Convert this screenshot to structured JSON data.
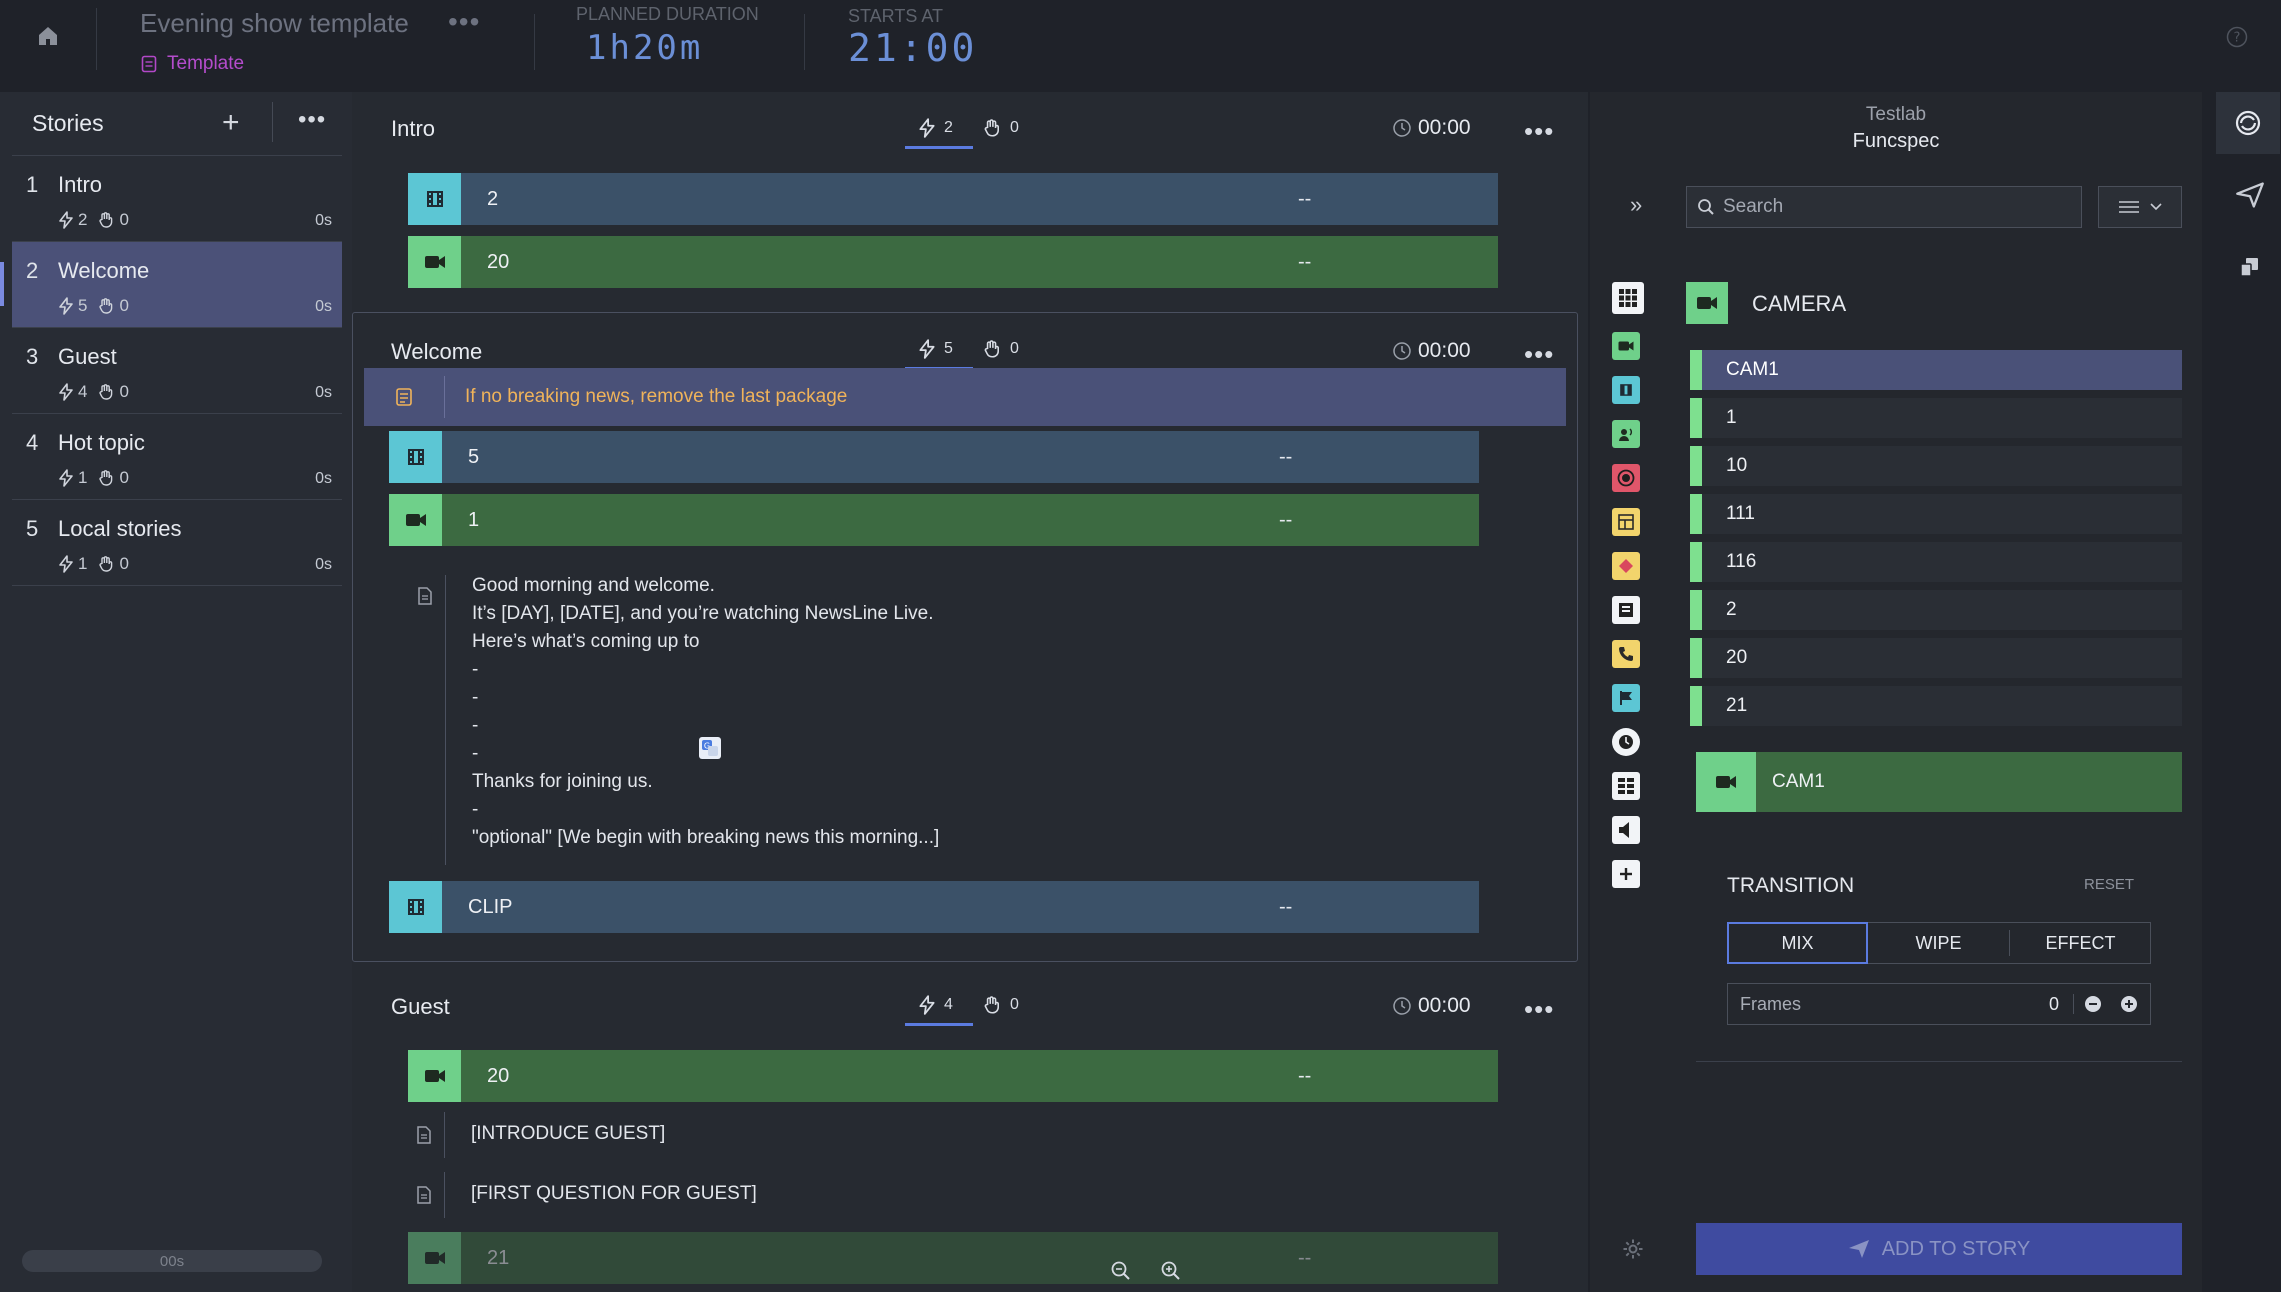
{
  "topbar": {
    "show_title": "Evening show template",
    "template_label": "Template",
    "planned_label": "PLANNED DURATION",
    "planned_value": "1h20m",
    "starts_label": "STARTS AT",
    "starts_value": "21:00"
  },
  "stories": {
    "header": "Stories",
    "items": [
      {
        "num": "1",
        "title": "Intro",
        "bolts": "2",
        "hands": "0",
        "time": "0s"
      },
      {
        "num": "2",
        "title": "Welcome",
        "bolts": "5",
        "hands": "0",
        "time": "0s"
      },
      {
        "num": "3",
        "title": "Guest",
        "bolts": "4",
        "hands": "0",
        "time": "0s"
      },
      {
        "num": "4",
        "title": "Hot topic",
        "bolts": "1",
        "hands": "0",
        "time": "0s"
      },
      {
        "num": "5",
        "title": "Local stories",
        "bolts": "1",
        "hands": "0",
        "time": "0s"
      }
    ],
    "footer_time": "00s"
  },
  "rundown": {
    "intro": {
      "title": "Intro",
      "bolts": "2",
      "hands": "0",
      "time": "00:00",
      "rows": [
        {
          "label": "2",
          "dash": "--"
        },
        {
          "label": "20",
          "dash": "--"
        }
      ]
    },
    "welcome": {
      "title": "Welcome",
      "bolts": "5",
      "hands": "0",
      "time": "00:00",
      "note": "If no breaking news, remove the last package",
      "rows": [
        {
          "label": "5",
          "dash": "--"
        },
        {
          "label": "1",
          "dash": "--"
        },
        {
          "label": "CLIP",
          "dash": "--"
        }
      ],
      "script": [
        "Good morning and welcome.",
        "It’s [DAY], [DATE], and you’re watching NewsLine Live.",
        "Here’s what’s coming up to",
        "-",
        "-",
        "-",
        "-",
        "Thanks for joining us.",
        "-",
        "\"optional\" [We begin with breaking news this morning...]"
      ]
    },
    "guest": {
      "title": "Guest",
      "bolts": "4",
      "hands": "0",
      "time": "00:00",
      "rows": [
        {
          "label": "20",
          "dash": "--"
        },
        {
          "label": "21",
          "dash": "--"
        }
      ],
      "script": [
        "[INTRODUCE GUEST]",
        "[FIRST QUESTION FOR GUEST]"
      ]
    }
  },
  "right": {
    "studio": "Testlab",
    "spec": "Funcspec",
    "search_placeholder": "Search",
    "category_title": "CAMERA",
    "cameras": [
      "CAM1",
      "1",
      "10",
      "111",
      "116",
      "2",
      "20",
      "21"
    ],
    "selected_camera": "CAM1",
    "transition_title": "TRANSITION",
    "reset_label": "RESET",
    "transitions": [
      "MIX",
      "WIPE",
      "EFFECT"
    ],
    "frames_label": "Frames",
    "frames_value": "0",
    "add_button": "ADD TO STORY"
  },
  "colors": {
    "clip": "#5cc6d4",
    "camera": "#6fd08a",
    "accent": "#5b7be0",
    "note": "#f0b35a",
    "selected": "#4b5178"
  }
}
